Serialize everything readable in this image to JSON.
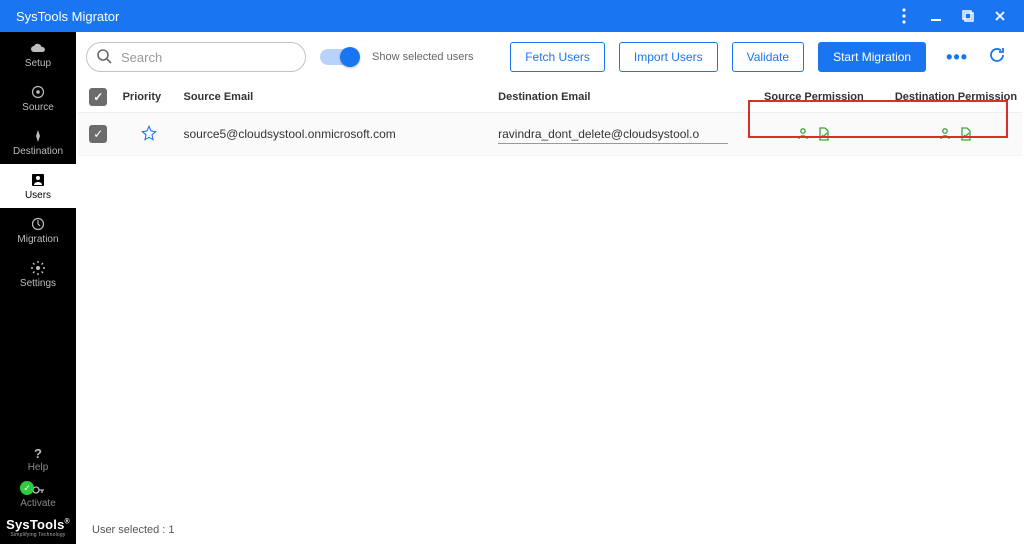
{
  "window": {
    "title": "SysTools Migrator"
  },
  "sidebar": {
    "items": [
      {
        "label": "Setup"
      },
      {
        "label": "Source"
      },
      {
        "label": "Destination"
      },
      {
        "label": "Users"
      },
      {
        "label": "Migration"
      },
      {
        "label": "Settings"
      }
    ],
    "help": {
      "label": "Help"
    },
    "activate": {
      "label": "Activate"
    },
    "brand": {
      "line1": "SysTools",
      "line2": "Simplifying Technology"
    }
  },
  "toolbar": {
    "search_placeholder": "Search",
    "toggle_label": "Show selected users",
    "buttons": {
      "fetch": "Fetch Users",
      "import": "Import Users",
      "validate": "Validate",
      "start": "Start Migration"
    }
  },
  "table": {
    "headers": {
      "priority": "Priority",
      "source": "Source Email",
      "dest": "Destination Email",
      "srcperm": "Source Permission",
      "dstperm": "Destination Permission"
    },
    "rows": [
      {
        "source": "source5@cloudsystool.onmicrosoft.com",
        "dest": "ravindra_dont_delete@cloudsystool.o"
      }
    ]
  },
  "footer": {
    "status": "User selected : 1"
  }
}
